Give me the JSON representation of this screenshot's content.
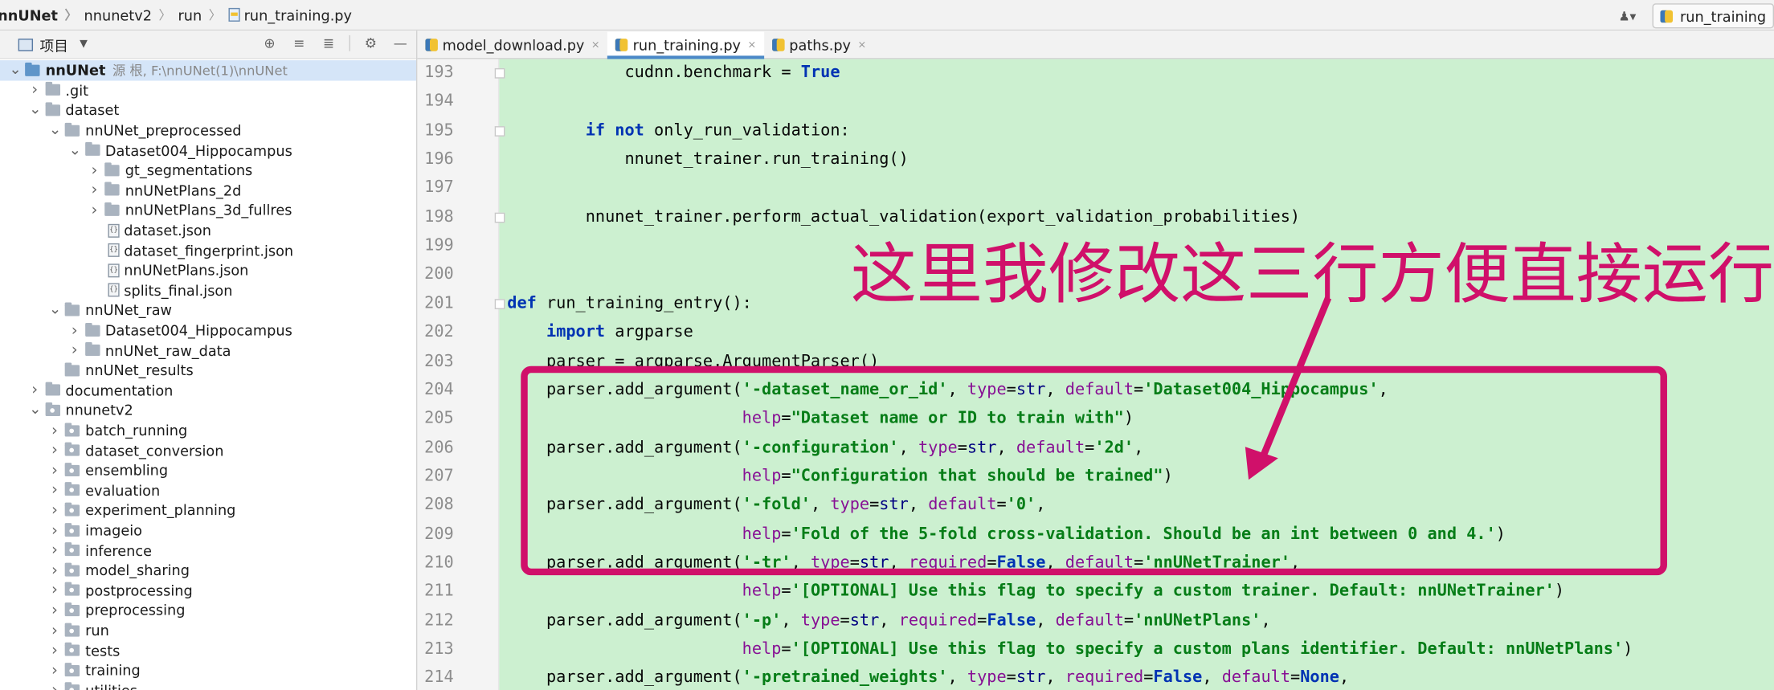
{
  "breadcrumb": [
    "nnUNet",
    "nnunetv2",
    "run",
    "run_training.py"
  ],
  "run_config": "run_training",
  "project_panel": {
    "title": "项目",
    "tree": [
      {
        "depth": 0,
        "label": "nnUNet",
        "note": "源 根, F:\\nnUNet(1)\\nnUNet",
        "kind": "root",
        "expanded": true
      },
      {
        "depth": 1,
        "label": ".git",
        "kind": "folder",
        "expanded": false
      },
      {
        "depth": 1,
        "label": "dataset",
        "kind": "folder",
        "expanded": true
      },
      {
        "depth": 2,
        "label": "nnUNet_preprocessed",
        "kind": "folder",
        "expanded": true
      },
      {
        "depth": 3,
        "label": "Dataset004_Hippocampus",
        "kind": "folder",
        "expanded": true
      },
      {
        "depth": 4,
        "label": "gt_segmentations",
        "kind": "folder",
        "expanded": false
      },
      {
        "depth": 4,
        "label": "nnUNetPlans_2d",
        "kind": "folder",
        "expanded": false
      },
      {
        "depth": 4,
        "label": "nnUNetPlans_3d_fullres",
        "kind": "folder",
        "expanded": false
      },
      {
        "depth": 4,
        "label": "dataset.json",
        "kind": "json"
      },
      {
        "depth": 4,
        "label": "dataset_fingerprint.json",
        "kind": "json"
      },
      {
        "depth": 4,
        "label": "nnUNetPlans.json",
        "kind": "json"
      },
      {
        "depth": 4,
        "label": "splits_final.json",
        "kind": "json"
      },
      {
        "depth": 2,
        "label": "nnUNet_raw",
        "kind": "folder",
        "expanded": true
      },
      {
        "depth": 3,
        "label": "Dataset004_Hippocampus",
        "kind": "folder",
        "expanded": false
      },
      {
        "depth": 3,
        "label": "nnUNet_raw_data",
        "kind": "folder",
        "expanded": false
      },
      {
        "depth": 2,
        "label": "nnUNet_results",
        "kind": "folder",
        "leaf": true
      },
      {
        "depth": 1,
        "label": "documentation",
        "kind": "folder",
        "expanded": false
      },
      {
        "depth": 1,
        "label": "nnunetv2",
        "kind": "pkg",
        "expanded": true
      },
      {
        "depth": 2,
        "label": "batch_running",
        "kind": "pkg",
        "expanded": false
      },
      {
        "depth": 2,
        "label": "dataset_conversion",
        "kind": "pkg",
        "expanded": false
      },
      {
        "depth": 2,
        "label": "ensembling",
        "kind": "pkg",
        "expanded": false
      },
      {
        "depth": 2,
        "label": "evaluation",
        "kind": "pkg",
        "expanded": false
      },
      {
        "depth": 2,
        "label": "experiment_planning",
        "kind": "pkg",
        "expanded": false
      },
      {
        "depth": 2,
        "label": "imageio",
        "kind": "pkg",
        "expanded": false
      },
      {
        "depth": 2,
        "label": "inference",
        "kind": "pkg",
        "expanded": false
      },
      {
        "depth": 2,
        "label": "model_sharing",
        "kind": "pkg",
        "expanded": false
      },
      {
        "depth": 2,
        "label": "postprocessing",
        "kind": "pkg",
        "expanded": false
      },
      {
        "depth": 2,
        "label": "preprocessing",
        "kind": "pkg",
        "expanded": false
      },
      {
        "depth": 2,
        "label": "run",
        "kind": "pkg",
        "expanded": false
      },
      {
        "depth": 2,
        "label": "tests",
        "kind": "pkg",
        "expanded": false
      },
      {
        "depth": 2,
        "label": "training",
        "kind": "pkg",
        "expanded": false
      },
      {
        "depth": 2,
        "label": "utilities",
        "kind": "pkg",
        "expanded": false
      }
    ]
  },
  "editor_tabs": [
    {
      "label": "model_download.py",
      "active": false
    },
    {
      "label": "run_training.py",
      "active": true
    },
    {
      "label": "paths.py",
      "active": false
    }
  ],
  "code_lines": [
    {
      "n": "193",
      "t": [
        [
          "            cudnn.benchmark = ",
          ""
        ],
        [
          "True",
          "kw"
        ]
      ]
    },
    {
      "n": "194",
      "t": []
    },
    {
      "n": "195",
      "t": [
        [
          "        ",
          ""
        ],
        [
          "if",
          "kw"
        ],
        [
          " ",
          ""
        ],
        [
          "not",
          "kw"
        ],
        [
          " only_run_validation:",
          ""
        ]
      ]
    },
    {
      "n": "196",
      "t": [
        [
          "            nnunet_trainer.run_training()",
          ""
        ]
      ]
    },
    {
      "n": "197",
      "t": []
    },
    {
      "n": "198",
      "t": [
        [
          "        nnunet_trainer.perform_actual_validation(export_validation_probabilities)",
          ""
        ]
      ]
    },
    {
      "n": "199",
      "t": []
    },
    {
      "n": "200",
      "t": []
    },
    {
      "n": "201",
      "t": [
        [
          "def",
          "kw"
        ],
        [
          " run_training_entry():",
          ""
        ]
      ]
    },
    {
      "n": "202",
      "t": [
        [
          "    ",
          ""
        ],
        [
          "import",
          "kw"
        ],
        [
          " argparse",
          ""
        ]
      ]
    },
    {
      "n": "203",
      "t": [
        [
          "    parser = argparse.ArgumentParser()",
          ""
        ]
      ]
    },
    {
      "n": "204",
      "t": [
        [
          "    parser.add_argument(",
          ""
        ],
        [
          "'-dataset_name_or_id'",
          "str"
        ],
        [
          ", ",
          ""
        ],
        [
          "type",
          "kwa"
        ],
        [
          "=",
          ""
        ],
        [
          "str",
          "bi"
        ],
        [
          ", ",
          ""
        ],
        [
          "default",
          "kwa"
        ],
        [
          "=",
          ""
        ],
        [
          "'Dataset004_Hippocampus'",
          "str"
        ],
        [
          ",",
          ""
        ]
      ]
    },
    {
      "n": "205",
      "t": [
        [
          "                        ",
          ""
        ],
        [
          "help",
          "kwa"
        ],
        [
          "=",
          ""
        ],
        [
          "\"Dataset name or ID to train with\"",
          "str"
        ],
        [
          ")",
          ""
        ]
      ]
    },
    {
      "n": "206",
      "t": [
        [
          "    parser.add_argument(",
          ""
        ],
        [
          "'-configuration'",
          "str"
        ],
        [
          ", ",
          ""
        ],
        [
          "type",
          "kwa"
        ],
        [
          "=",
          ""
        ],
        [
          "str",
          "bi"
        ],
        [
          ", ",
          ""
        ],
        [
          "default",
          "kwa"
        ],
        [
          "=",
          ""
        ],
        [
          "'2d'",
          "str"
        ],
        [
          ",",
          ""
        ]
      ]
    },
    {
      "n": "207",
      "t": [
        [
          "                        ",
          ""
        ],
        [
          "help",
          "kwa"
        ],
        [
          "=",
          ""
        ],
        [
          "\"Configuration that should be trained\"",
          "str"
        ],
        [
          ")",
          ""
        ]
      ]
    },
    {
      "n": "208",
      "t": [
        [
          "    parser.add_argument(",
          ""
        ],
        [
          "'-fold'",
          "str"
        ],
        [
          ", ",
          ""
        ],
        [
          "type",
          "kwa"
        ],
        [
          "=",
          ""
        ],
        [
          "str",
          "bi"
        ],
        [
          ", ",
          ""
        ],
        [
          "default",
          "kwa"
        ],
        [
          "=",
          ""
        ],
        [
          "'0'",
          "str"
        ],
        [
          ",",
          ""
        ]
      ]
    },
    {
      "n": "209",
      "t": [
        [
          "                        ",
          ""
        ],
        [
          "help",
          "kwa"
        ],
        [
          "=",
          ""
        ],
        [
          "'Fold of the 5-fold cross-validation. Should be an int between 0 and 4.'",
          "str"
        ],
        [
          ")",
          ""
        ]
      ]
    },
    {
      "n": "210",
      "t": [
        [
          "    parser.add_argument(",
          ""
        ],
        [
          "'-tr'",
          "str"
        ],
        [
          ", ",
          ""
        ],
        [
          "type",
          "kwa"
        ],
        [
          "=",
          ""
        ],
        [
          "str",
          "bi"
        ],
        [
          ", ",
          ""
        ],
        [
          "required",
          "kwa"
        ],
        [
          "=",
          ""
        ],
        [
          "False",
          "kw"
        ],
        [
          ", ",
          ""
        ],
        [
          "default",
          "kwa"
        ],
        [
          "=",
          ""
        ],
        [
          "'nnUNetTrainer'",
          "str"
        ],
        [
          ",",
          ""
        ]
      ]
    },
    {
      "n": "211",
      "t": [
        [
          "                        ",
          ""
        ],
        [
          "help",
          "kwa"
        ],
        [
          "=",
          ""
        ],
        [
          "'[OPTIONAL] Use this flag to specify a custom trainer. Default: nnUNetTrainer'",
          "str"
        ],
        [
          ")",
          ""
        ]
      ]
    },
    {
      "n": "212",
      "t": [
        [
          "    parser.add_argument(",
          ""
        ],
        [
          "'-p'",
          "str"
        ],
        [
          ", ",
          ""
        ],
        [
          "type",
          "kwa"
        ],
        [
          "=",
          ""
        ],
        [
          "str",
          "bi"
        ],
        [
          ", ",
          ""
        ],
        [
          "required",
          "kwa"
        ],
        [
          "=",
          ""
        ],
        [
          "False",
          "kw"
        ],
        [
          ", ",
          ""
        ],
        [
          "default",
          "kwa"
        ],
        [
          "=",
          ""
        ],
        [
          "'nnUNetPlans'",
          "str"
        ],
        [
          ",",
          ""
        ]
      ]
    },
    {
      "n": "213",
      "t": [
        [
          "                        ",
          ""
        ],
        [
          "help",
          "kwa"
        ],
        [
          "=",
          ""
        ],
        [
          "'[OPTIONAL] Use this flag to specify a custom plans identifier. Default: nnUNetPlans'",
          "str"
        ],
        [
          ")",
          ""
        ]
      ]
    },
    {
      "n": "214",
      "t": [
        [
          "    parser.add_argument(",
          ""
        ],
        [
          "'-pretrained_weights'",
          "str"
        ],
        [
          ", ",
          ""
        ],
        [
          "type",
          "kwa"
        ],
        [
          "=",
          ""
        ],
        [
          "str",
          "bi"
        ],
        [
          ", ",
          ""
        ],
        [
          "required",
          "kwa"
        ],
        [
          "=",
          ""
        ],
        [
          "False",
          "kw"
        ],
        [
          ", ",
          ""
        ],
        [
          "default",
          "kwa"
        ],
        [
          "=",
          ""
        ],
        [
          "None",
          "kw"
        ],
        [
          ",",
          ""
        ]
      ]
    }
  ],
  "annotation": "这里我修改这三行方便直接运行",
  "colors": {
    "annotation": "#d0106a",
    "line_highlight": "#ccf0d0",
    "keyword": "#0033b3",
    "string": "#067d17"
  }
}
